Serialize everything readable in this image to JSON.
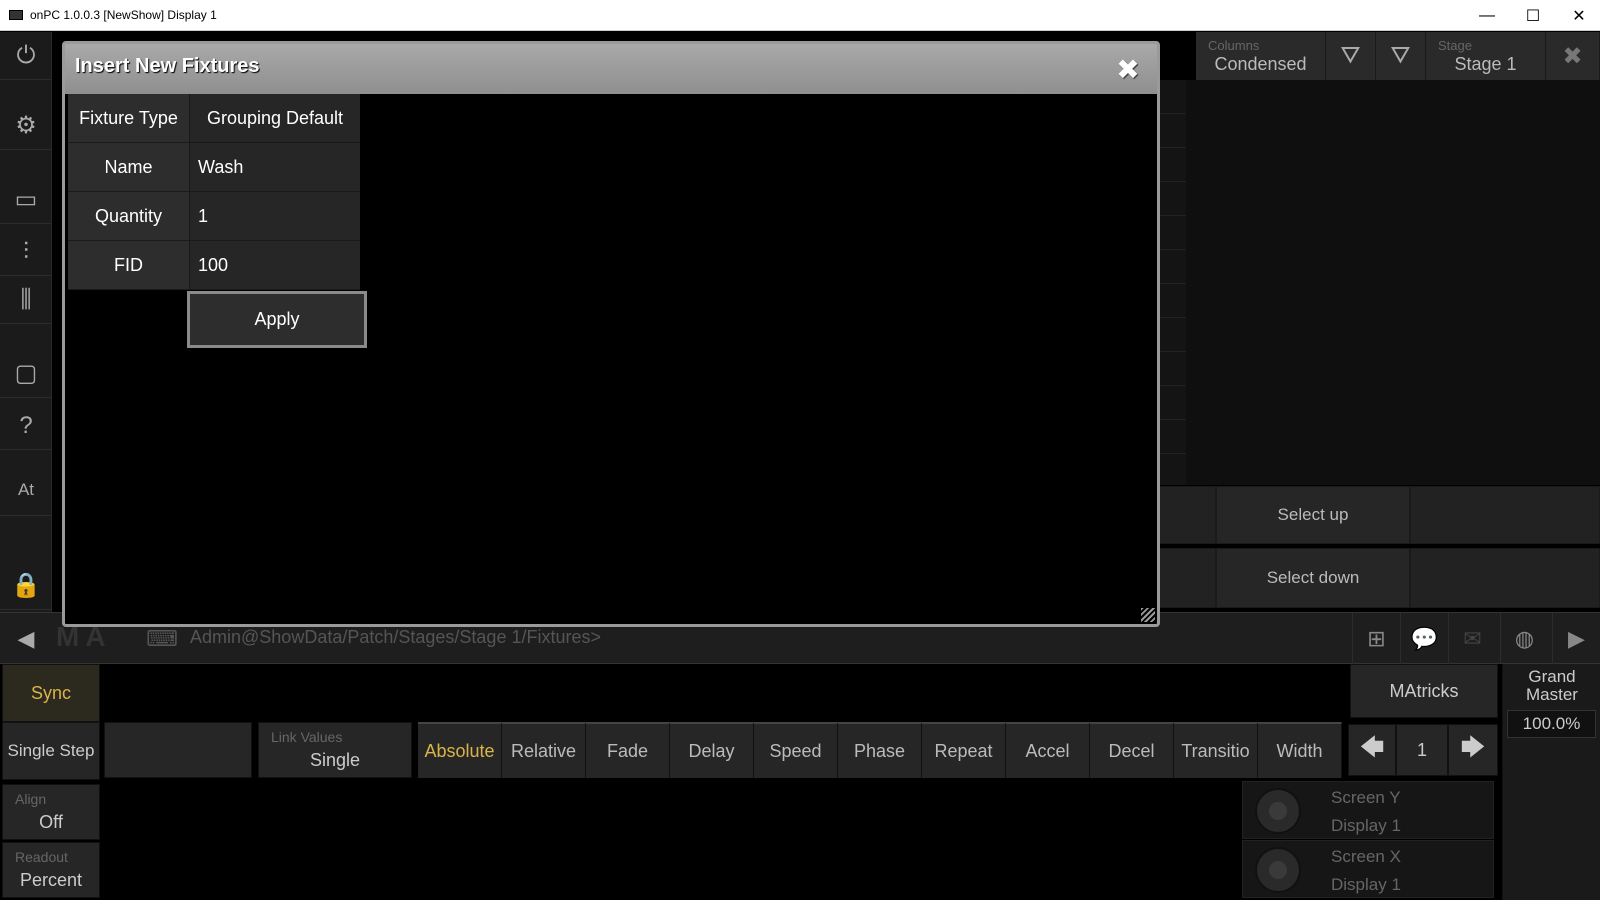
{
  "window": {
    "title": "onPC 1.0.0.3 [NewShow] Display 1",
    "min_icon": "—",
    "max_icon": "☐",
    "close_icon": "✕"
  },
  "sidebar": {
    "at_label": "At"
  },
  "toolbar": {
    "columns_caption": "Columns",
    "columns_value": "Condensed",
    "stage_caption": "Stage",
    "stage_value": "Stage 1"
  },
  "right": {
    "select_up": "Select up",
    "select_down": "Select down"
  },
  "cmdline": {
    "text": "Admin@ShowData/Patch/Stages/Stage 1/Fixtures>"
  },
  "bottom": {
    "sync": "Sync",
    "single_step": "Single Step",
    "align_caption": "Align",
    "align_value": "Off",
    "readout_caption": "Readout",
    "readout_value": "Percent",
    "link_caption": "Link Values",
    "link_value": "Single",
    "tabs": [
      "Absolute",
      "Relative",
      "Fade",
      "Delay",
      "Speed",
      "Phase",
      "Repeat",
      "Accel",
      "Decel",
      "Transitio",
      "Width"
    ],
    "matricks": "MAtricks",
    "page_number": "1",
    "encoder1_line1": "Screen Y",
    "encoder1_line2": "Display 1",
    "encoder2_line1": "Screen X",
    "encoder2_line2": "Display 1",
    "grand_master": "Grand Master",
    "grand_master_value": "100.0%"
  },
  "dialog": {
    "title": "Insert New Fixtures",
    "fixture_type_label": "Fixture Type",
    "fixture_type_value": "Grouping Default",
    "name_label": "Name",
    "name_value": "Wash",
    "quantity_label": "Quantity",
    "quantity_value": "1",
    "fid_label": "FID",
    "fid_value": "100",
    "apply_label": "Apply"
  }
}
